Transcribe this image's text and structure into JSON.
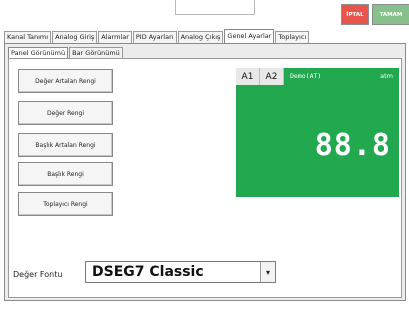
{
  "toolbar": {
    "cancel_label": "İPTAL",
    "ok_label": "TAMAM"
  },
  "tabs": [
    {
      "label": "Kanal Tanımı"
    },
    {
      "label": "Analog Giriş"
    },
    {
      "label": "Alarmlar"
    },
    {
      "label": "PID Ayarları"
    },
    {
      "label": "Analog Çıkış"
    },
    {
      "label": "Genel Ayarlar"
    },
    {
      "label": "Toplayıcı"
    }
  ],
  "subtabs": [
    {
      "label": "Panel Görünümü"
    },
    {
      "label": "Bar Görünümü"
    }
  ],
  "color_buttons": [
    {
      "label": "Değer Artalan Rengi"
    },
    {
      "label": "Değer Rengi"
    },
    {
      "label": "Başlık Artalan Rengi"
    },
    {
      "label": "Başlık Rengi"
    },
    {
      "label": "Toplayıcı Rengi"
    }
  ],
  "preview": {
    "a1": "A1",
    "a2": "A2",
    "name": "Demo(AT)",
    "unit": "atm",
    "value": "88.8",
    "background": "#22a84f"
  },
  "font": {
    "label": "Değer Fontu",
    "selected": "DSEG7 Classic"
  },
  "colors": {
    "cancel": "#e8554d",
    "ok": "#86c08b"
  }
}
